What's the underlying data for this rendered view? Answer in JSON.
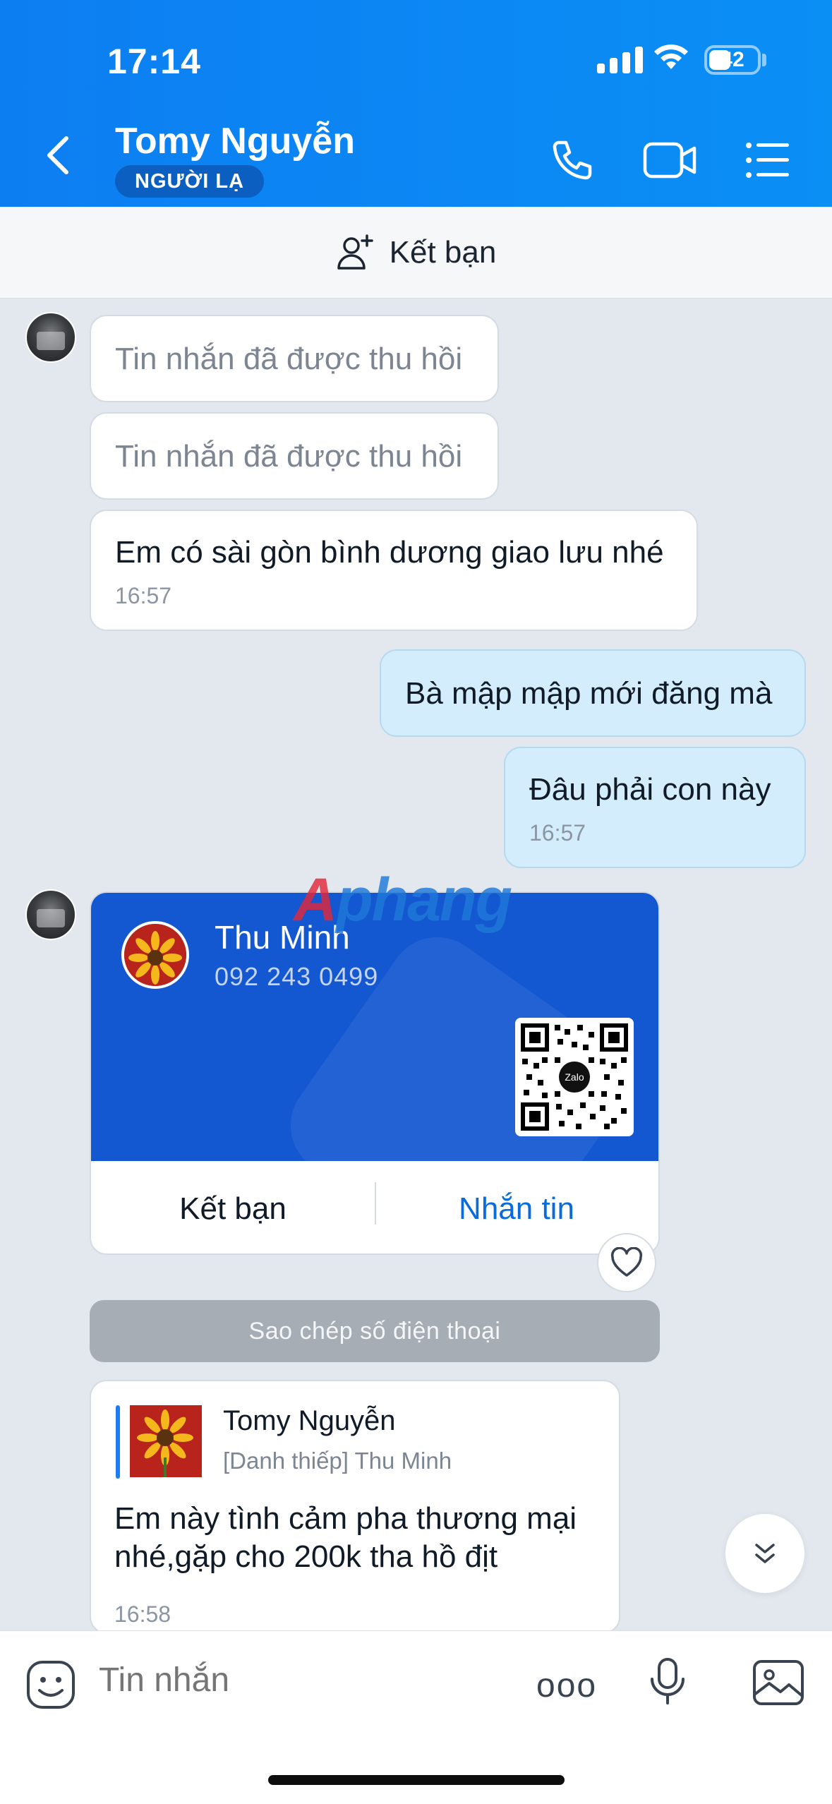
{
  "status": {
    "time": "17:14",
    "battery": "42"
  },
  "header": {
    "name": "Tomy Nguyễn",
    "badge": "NGƯỜI LẠ"
  },
  "add_friend_bar": {
    "label": "Kết bạn"
  },
  "messages": {
    "recalled_1": "Tin nhắn đã được thu hồi",
    "recalled_2": "Tin nhắn đã được thu hồi",
    "m3": {
      "text": "Em có sài gòn bình dương giao lưu nhé",
      "time": "16:57"
    },
    "m4": {
      "text": "Bà mập mập mới đăng mà"
    },
    "m5": {
      "text": "Đâu phải con này",
      "time": "16:57"
    }
  },
  "card": {
    "name": "Thu Minh",
    "phone": "092 243 0499",
    "qr_label": "Zalo",
    "add_friend": "Kết bạn",
    "message": "Nhắn tin",
    "copy_phone": "Sao chép số điện thoại"
  },
  "reply": {
    "quote_name": "Tomy Nguyễn",
    "quote_sub": "[Danh thiếp] Thu Minh",
    "text": "Em này tình cảm pha thương mại nhé,gặp cho 200k tha hồ địt",
    "time": "16:58"
  },
  "input": {
    "placeholder": "Tin nhắn",
    "more_label": "ooo"
  },
  "watermark": {
    "part1": "A",
    "part2": "phang"
  },
  "colors": {
    "header_blue": "#0d7ef2",
    "card_blue": "#1357d1",
    "link_blue": "#0a6bdc",
    "mine_bubble": "#d4edfc"
  }
}
